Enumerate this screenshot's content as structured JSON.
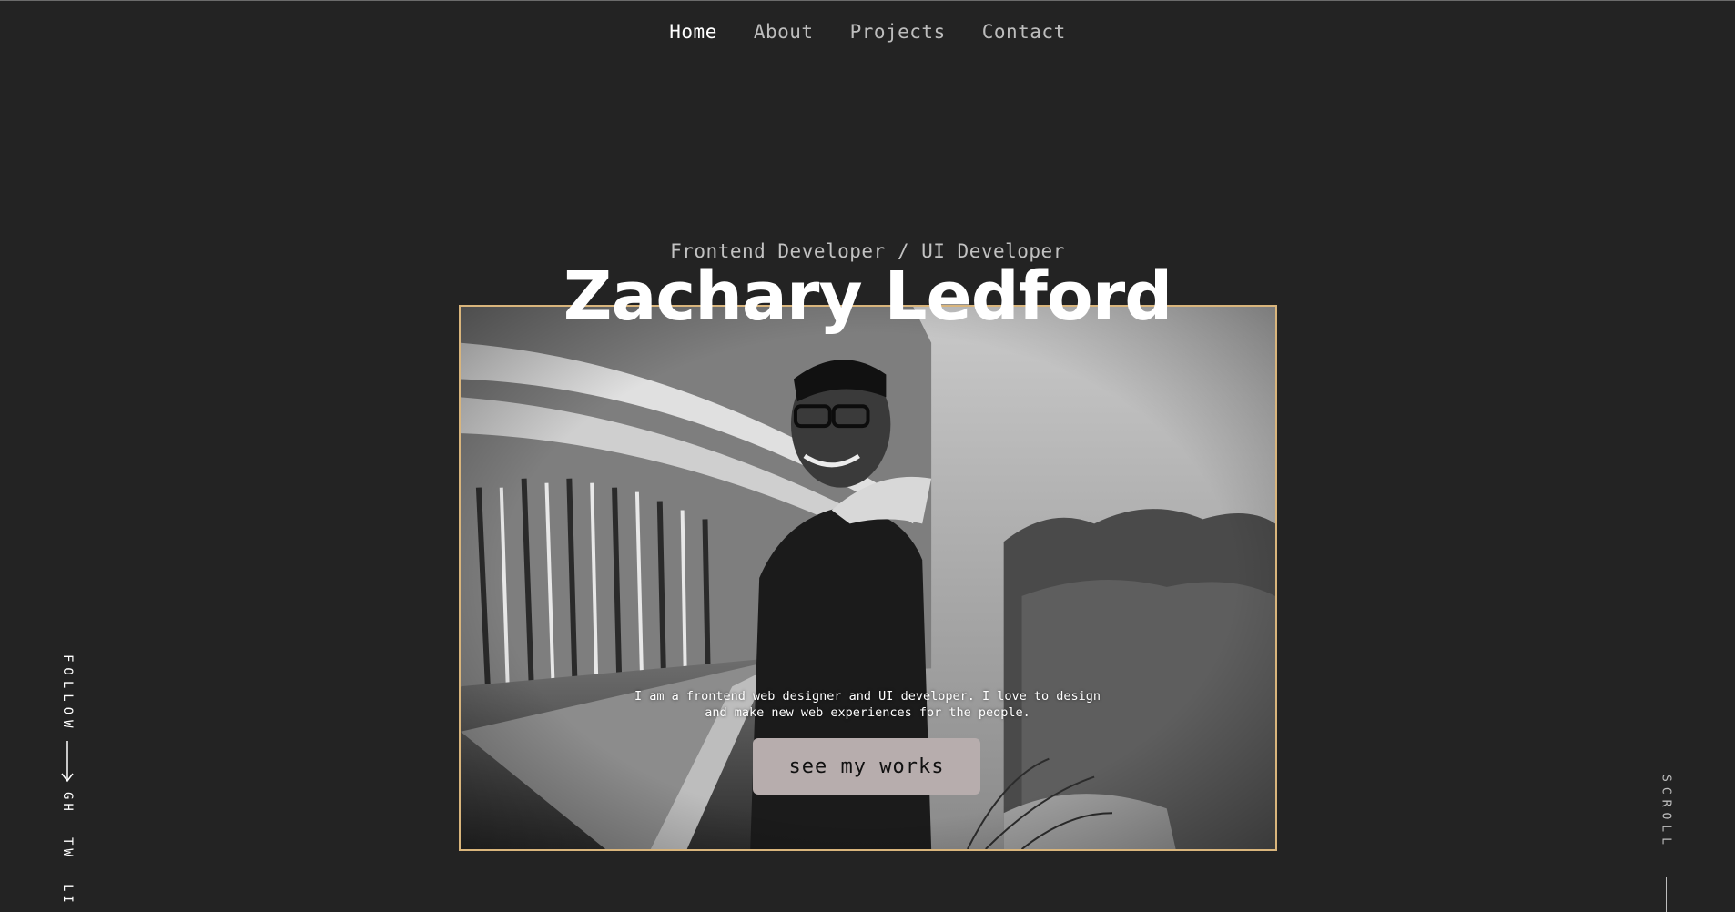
{
  "nav": {
    "items": [
      {
        "label": "Home",
        "active": true
      },
      {
        "label": "About",
        "active": false
      },
      {
        "label": "Projects",
        "active": false
      },
      {
        "label": "Contact",
        "active": false
      }
    ]
  },
  "hero": {
    "subtitle": "Frontend Developer / UI Developer",
    "name": "Zachary Ledford",
    "bio_line1": "I am a frontend web designer and UI developer. I love to design",
    "bio_line2": "and make new web experiences for the people.",
    "cta_label": "see my works"
  },
  "follow": {
    "label": "FOLLOW",
    "links": [
      "GH",
      "TW",
      "LI"
    ]
  },
  "scroll": {
    "label": "SCROLL"
  },
  "colors": {
    "background": "#232323",
    "photo_border": "#d9b57c",
    "cta_background": "#b7adad",
    "text": "#ffffff",
    "muted_text": "#bdbdbd"
  },
  "icons": {
    "follow_arrow": "arrow-down-icon"
  }
}
